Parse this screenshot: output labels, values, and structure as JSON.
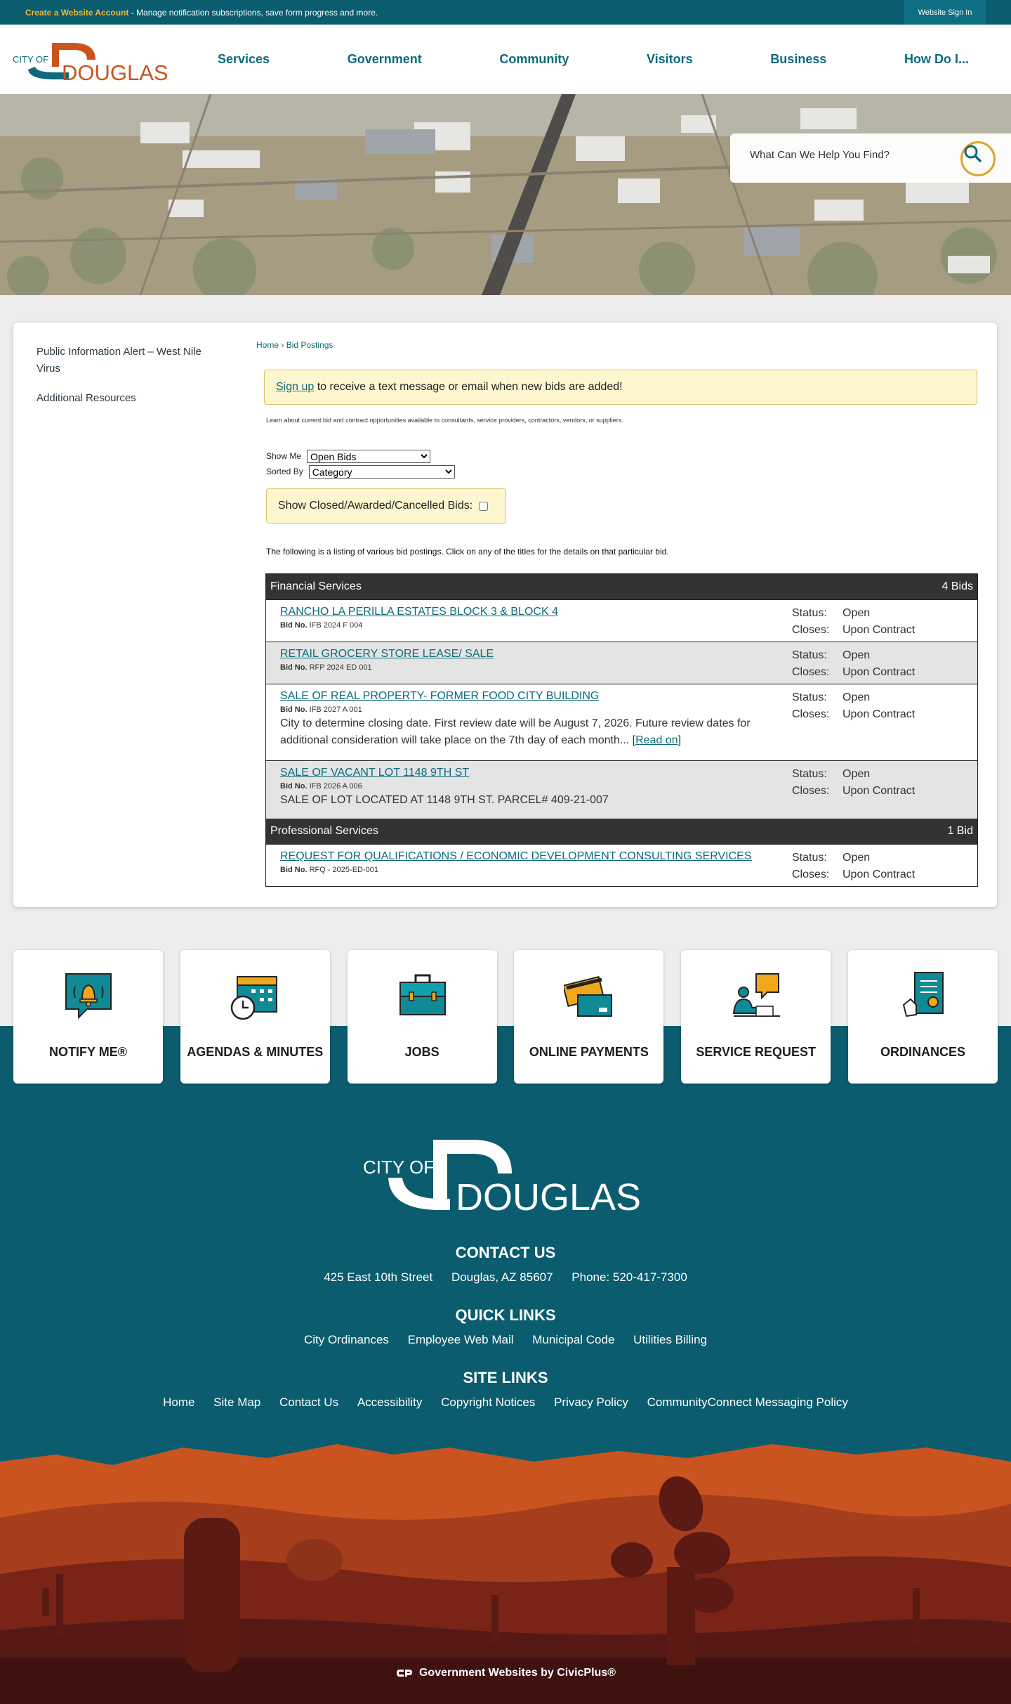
{
  "topbar": {
    "create_link": "Create a Website Account",
    "message": " - Manage notification subscriptions, save form progress and more.",
    "signin": "Website Sign In"
  },
  "logo": {
    "city_of": "CITY OF",
    "name": "DOUGLAS"
  },
  "nav": [
    "Services",
    "Government",
    "Community",
    "Visitors",
    "Business",
    "How Do I..."
  ],
  "search": {
    "placeholder": "What Can We Help You Find?"
  },
  "sidebar": [
    "Public Information Alert – West Nile Virus",
    "Additional Resources"
  ],
  "breadcrumb": {
    "home": "Home",
    "sep": "›",
    "current": "Bid Postings"
  },
  "alert": {
    "link": "Sign up",
    "text": " to receive a text message or email when new bids are added!"
  },
  "intro": "Learn about current bid and contract opportunities available to consultants, service providers, contractors, vendors, or suppliers.",
  "filters": {
    "show_me_label": "Show Me",
    "show_me_value": "Open Bids",
    "sorted_by_label": "Sorted By",
    "sorted_by_value": "Category",
    "closed_label": "Show Closed/Awarded/Cancelled Bids:"
  },
  "listing_text": "The following is a listing of various bid postings. Click on any of the titles for the details on that particular bid.",
  "bid_labels": {
    "bid_no": "Bid No.",
    "status": "Status:",
    "closes": "Closes:",
    "read_on": "Read on"
  },
  "categories": [
    {
      "name": "Financial Services",
      "count": "4 Bids",
      "bids": [
        {
          "title": "RANCHO LA PERILLA ESTATES BLOCK 3 & BLOCK 4",
          "bid_no": "IFB 2024 F 004",
          "desc": "",
          "status": "Open",
          "closes": "Upon Contract"
        },
        {
          "title": "RETAIL GROCERY STORE LEASE/ SALE",
          "bid_no": "RFP 2024 ED 001",
          "desc": "",
          "status": "Open",
          "closes": "Upon Contract"
        },
        {
          "title": "SALE OF REAL PROPERTY- FORMER FOOD CITY BUILDING",
          "bid_no": "IFB 2027 A 001",
          "desc": "City to determine closing date. First review date will be August 7, 2026. Future review dates for additional consideration will take place on the 7th day of each month...",
          "status": "Open",
          "closes": "Upon Contract"
        },
        {
          "title": "SALE OF VACANT LOT 1148 9TH ST",
          "bid_no": "IFB 2026 A 006",
          "desc": "SALE OF LOT LOCATED AT 1148 9TH ST. PARCEL# 409-21-007",
          "status": "Open",
          "closes": "Upon Contract"
        }
      ]
    },
    {
      "name": "Professional Services",
      "count": "1 Bid",
      "bids": [
        {
          "title": "REQUEST FOR QUALIFICATIONS / ECONOMIC DEVELOPMENT CONSULTING SERVICES",
          "bid_no": "RFQ - 2025-ED-001",
          "desc": "",
          "status": "Open",
          "closes": "Upon Contract"
        }
      ]
    }
  ],
  "tiles": [
    "NOTIFY ME®",
    "AGENDAS & MINUTES",
    "JOBS",
    "ONLINE PAYMENTS",
    "SERVICE REQUEST",
    "ORDINANCES"
  ],
  "footer": {
    "contact_heading": "CONTACT US",
    "contact": [
      "425 East 10th Street",
      "Douglas, AZ 85607",
      "Phone: 520-417-7300"
    ],
    "quick_heading": "QUICK LINKS",
    "quick": [
      "City Ordinances",
      "Employee Web Mail",
      "Municipal Code",
      "Utilities Billing"
    ],
    "site_heading": "SITE LINKS",
    "site": [
      "Home",
      "Site Map",
      "Contact Us",
      "Accessibility",
      "Copyright Notices",
      "Privacy Policy",
      "CommunityConnect Messaging Policy"
    ],
    "civicplus": "Government Websites by CivicPlus®"
  },
  "colors": {
    "teal": "#0a5c6e",
    "accent": "#f2b830",
    "orange": "#c9541f",
    "highlight": "#fdf6cf"
  }
}
